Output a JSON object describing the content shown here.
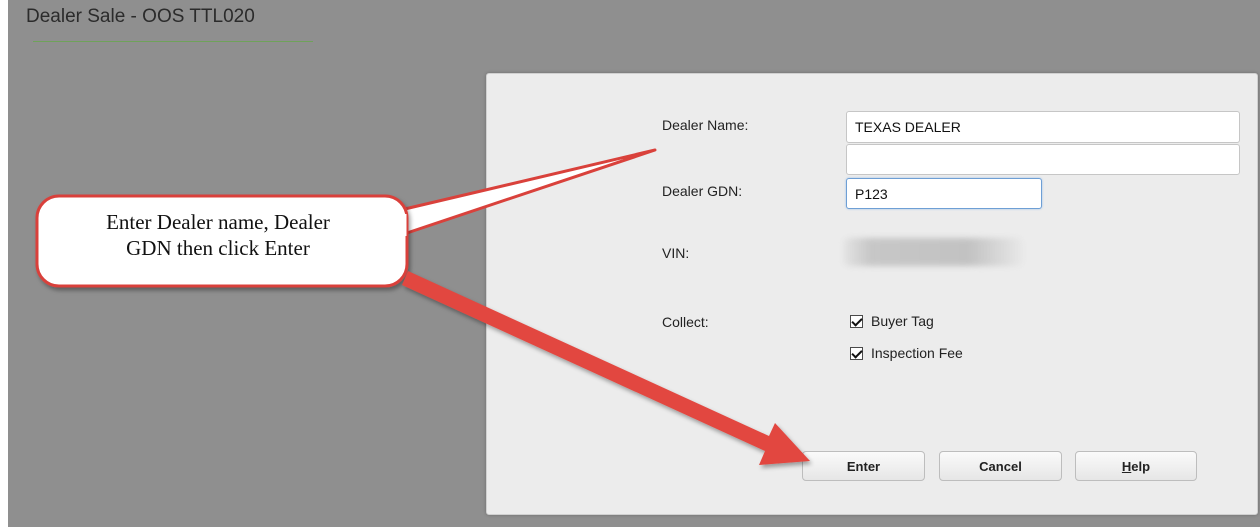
{
  "page": {
    "title": "Dealer Sale - OOS TTL020"
  },
  "form": {
    "dealer_name_label": "Dealer Name:",
    "dealer_name_value": "TEXAS DEALER",
    "dealer_name_line2_value": "",
    "dealer_gdn_label": "Dealer GDN:",
    "dealer_gdn_value": "P123",
    "vin_label": "VIN:",
    "collect_label": "Collect:",
    "collect_options": [
      {
        "label": "Buyer Tag",
        "checked": true
      },
      {
        "label": "Inspection Fee",
        "checked": true
      }
    ]
  },
  "buttons": {
    "enter_label": "Enter",
    "cancel_label": "Cancel",
    "help_mnemonic": "H",
    "help_rest": "elp"
  },
  "callout": {
    "line1": "Enter Dealer name, Dealer",
    "line2": "GDN then click Enter"
  },
  "colors": {
    "background": "#8f8f8f",
    "dialog": "#ececec",
    "callout_border": "#d9413b",
    "arrow": "#e2473f"
  }
}
